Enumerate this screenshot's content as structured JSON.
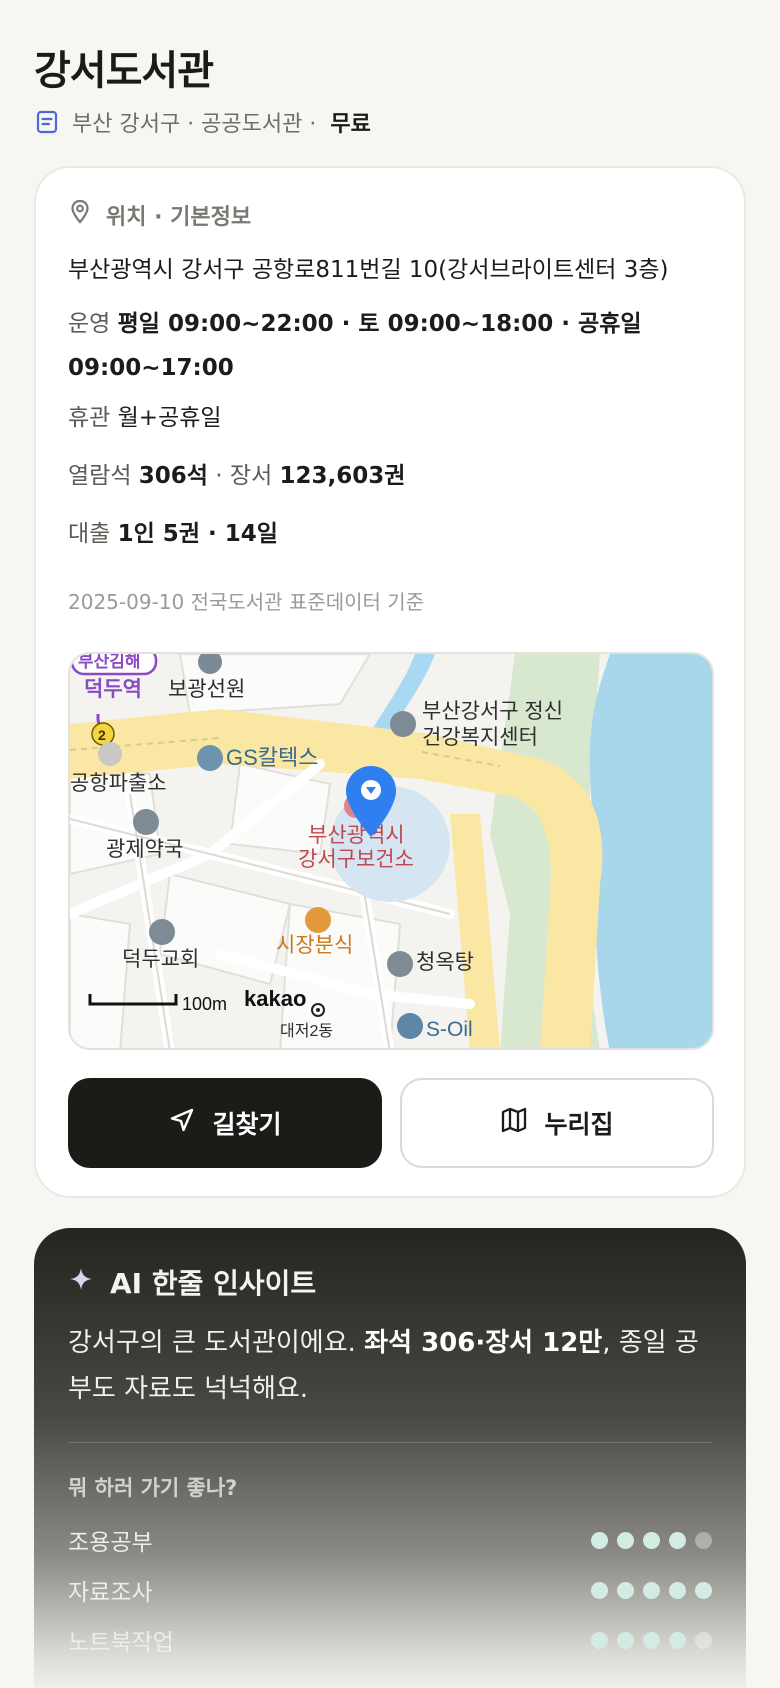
{
  "header": {
    "title": "강서도서관",
    "meta_prefix": "부산 강서구 · 공공도서관 ·",
    "fee": "무료"
  },
  "info": {
    "section_title": "위치 · 기본정보",
    "address": "부산광역시 강서구 공항로811번길 10(강서브라이트센터 3층)",
    "hours_label": "운영",
    "hours_value": "평일 09:00~22:00 · 토 09:00~18:00 · 공휴일 09:00~17:00",
    "closed_label": "휴관",
    "closed_value": "월+공휴일",
    "seats_label": "열람석",
    "seats_value": "306석",
    "books_label": "· 장서",
    "books_value": "123,603권",
    "loan_label": "대출",
    "loan_value": "1인 5권 · 14일",
    "source_note": "2025-09-10 전국도서관 표준데이터 기준"
  },
  "map": {
    "labels": {
      "station": "덕두역",
      "station_line": "부산김해",
      "line_number": "2",
      "bogwang": "보광선원",
      "police": "공항파출소",
      "gas": "GS칼텍스",
      "pharmacy": "광제약국",
      "mental_health_1": "부산강서구 정신",
      "mental_health_2": "건강복지센터",
      "health_center_1": "부산광역시",
      "health_center_2": "강서구보건소",
      "snack": "시장분식",
      "church": "덕두교회",
      "bath": "청옥탕",
      "scale": "100m",
      "brand": "kakao",
      "partial_1": "S-Oil",
      "partial_2": "대저2동"
    }
  },
  "actions": {
    "directions": "길찾기",
    "nurizip": "누리집"
  },
  "ai": {
    "title": "AI 한줄 인사이트",
    "text_1": "강서구의 큰 도서관이에요.",
    "text_bold": "좌석 306·장서 12만",
    "text_2": ", 종일 공부도 자료도 넉넉해요.",
    "sub_title": "뭐 하러 가기 좋나?",
    "ratings": [
      {
        "label": "조용공부",
        "score": 4
      },
      {
        "label": "자료조사",
        "score": 5
      },
      {
        "label": "노트북작업",
        "score": 4
      }
    ]
  },
  "colors": {
    "primary_button": "#1c1b18",
    "map_pin": "#2f7ff0",
    "rating_dot": "#d3ece3"
  }
}
